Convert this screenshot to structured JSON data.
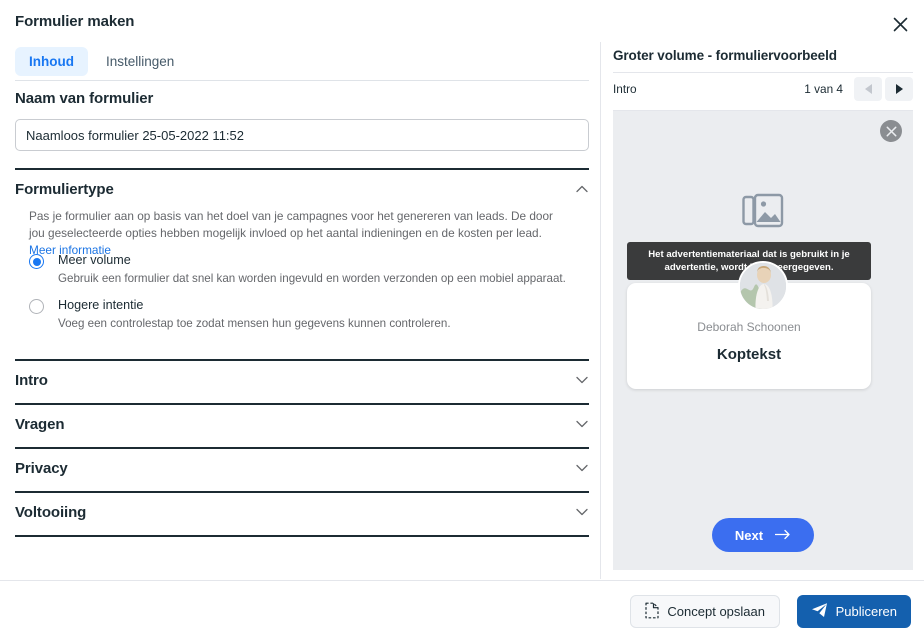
{
  "dialog": {
    "title": "Formulier maken",
    "close_icon": "close-icon"
  },
  "tabs": [
    {
      "label": "Inhoud",
      "active": true
    },
    {
      "label": "Instellingen",
      "active": false
    }
  ],
  "form_name": {
    "heading": "Naam van formulier",
    "value": "Naamloos formulier 25-05-2022 11:52",
    "placeholder": "Naam van formulier"
  },
  "form_type": {
    "heading": "Formuliertype",
    "expanded": true,
    "chevron_icon": "chevron-up-icon",
    "description": "Pas je formulier aan op basis van het doel van je campagnes voor het genereren van leads. De door jou geselecteerde opties hebben mogelijk invloed op het aantal indieningen en de kosten per lead.",
    "learn_more": "Meer informatie",
    "options": [
      {
        "label": "Meer volume",
        "description": "Gebruik een formulier dat snel kan worden ingevuld en worden verzonden op een mobiel apparaat.",
        "selected": true
      },
      {
        "label": "Hogere intentie",
        "description": "Voeg een controlestap toe zodat mensen hun gegevens kunnen controleren.",
        "selected": false
      }
    ]
  },
  "sections": [
    {
      "label": "Intro",
      "chevron_icon": "chevron-down-icon"
    },
    {
      "label": "Vragen",
      "chevron_icon": "chevron-down-icon"
    },
    {
      "label": "Privacy",
      "chevron_icon": "chevron-down-icon"
    },
    {
      "label": "Voltooiing",
      "chevron_icon": "chevron-down-icon"
    }
  ],
  "preview": {
    "title": "Groter volume - formuliervoorbeeld",
    "step_label": "Intro",
    "counter": "1 van 4",
    "prev_icon": "triangle-left-icon",
    "next_icon": "triangle-right-icon",
    "close_icon": "close-circle-icon",
    "media_icon": "image-stack-icon",
    "tooltip": "Het advertentiemateriaal dat is gebruikt in je advertentie, wordt hier weergegeven.",
    "avatar_icon": "avatar",
    "advertiser_name": "Deborah Schoonen",
    "headline": "Koptekst",
    "next_button": "Next",
    "next_button_icon": "arrow-right-icon"
  },
  "footer": {
    "save_draft_label": "Concept opslaan",
    "save_draft_icon": "document-icon",
    "publish_label": "Publiceren",
    "publish_icon": "paper-plane-icon"
  },
  "colors": {
    "accent_blue": "#1877f2",
    "link_blue": "#1b74e4",
    "publish_blue": "#1460ae",
    "next_blue": "#3b6ef0",
    "tab_active_bg": "#e7f3ff",
    "preview_bg": "#ebedf0",
    "tooltip_bg": "#3a3b3c",
    "text_primary": "#1c2b33",
    "text_muted": "#65676b"
  }
}
